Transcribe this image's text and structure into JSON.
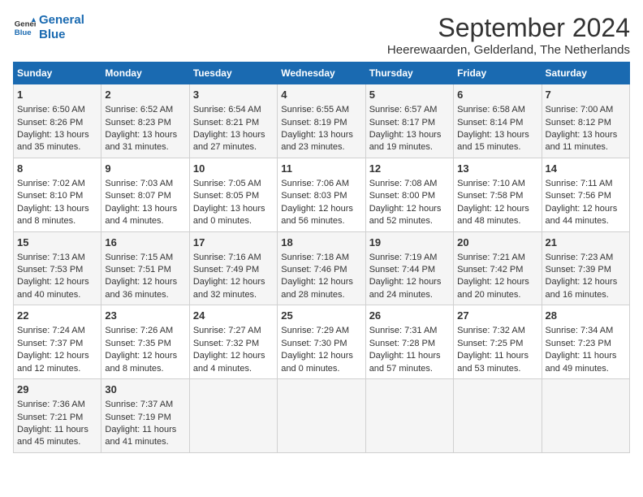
{
  "header": {
    "logo_line1": "General",
    "logo_line2": "Blue",
    "title": "September 2024",
    "subtitle": "Heerewaarden, Gelderland, The Netherlands"
  },
  "weekdays": [
    "Sunday",
    "Monday",
    "Tuesday",
    "Wednesday",
    "Thursday",
    "Friday",
    "Saturday"
  ],
  "weeks": [
    [
      {
        "day": "1",
        "lines": [
          "Sunrise: 6:50 AM",
          "Sunset: 8:26 PM",
          "Daylight: 13 hours",
          "and 35 minutes."
        ]
      },
      {
        "day": "2",
        "lines": [
          "Sunrise: 6:52 AM",
          "Sunset: 8:23 PM",
          "Daylight: 13 hours",
          "and 31 minutes."
        ]
      },
      {
        "day": "3",
        "lines": [
          "Sunrise: 6:54 AM",
          "Sunset: 8:21 PM",
          "Daylight: 13 hours",
          "and 27 minutes."
        ]
      },
      {
        "day": "4",
        "lines": [
          "Sunrise: 6:55 AM",
          "Sunset: 8:19 PM",
          "Daylight: 13 hours",
          "and 23 minutes."
        ]
      },
      {
        "day": "5",
        "lines": [
          "Sunrise: 6:57 AM",
          "Sunset: 8:17 PM",
          "Daylight: 13 hours",
          "and 19 minutes."
        ]
      },
      {
        "day": "6",
        "lines": [
          "Sunrise: 6:58 AM",
          "Sunset: 8:14 PM",
          "Daylight: 13 hours",
          "and 15 minutes."
        ]
      },
      {
        "day": "7",
        "lines": [
          "Sunrise: 7:00 AM",
          "Sunset: 8:12 PM",
          "Daylight: 13 hours",
          "and 11 minutes."
        ]
      }
    ],
    [
      {
        "day": "8",
        "lines": [
          "Sunrise: 7:02 AM",
          "Sunset: 8:10 PM",
          "Daylight: 13 hours",
          "and 8 minutes."
        ]
      },
      {
        "day": "9",
        "lines": [
          "Sunrise: 7:03 AM",
          "Sunset: 8:07 PM",
          "Daylight: 13 hours",
          "and 4 minutes."
        ]
      },
      {
        "day": "10",
        "lines": [
          "Sunrise: 7:05 AM",
          "Sunset: 8:05 PM",
          "Daylight: 13 hours",
          "and 0 minutes."
        ]
      },
      {
        "day": "11",
        "lines": [
          "Sunrise: 7:06 AM",
          "Sunset: 8:03 PM",
          "Daylight: 12 hours",
          "and 56 minutes."
        ]
      },
      {
        "day": "12",
        "lines": [
          "Sunrise: 7:08 AM",
          "Sunset: 8:00 PM",
          "Daylight: 12 hours",
          "and 52 minutes."
        ]
      },
      {
        "day": "13",
        "lines": [
          "Sunrise: 7:10 AM",
          "Sunset: 7:58 PM",
          "Daylight: 12 hours",
          "and 48 minutes."
        ]
      },
      {
        "day": "14",
        "lines": [
          "Sunrise: 7:11 AM",
          "Sunset: 7:56 PM",
          "Daylight: 12 hours",
          "and 44 minutes."
        ]
      }
    ],
    [
      {
        "day": "15",
        "lines": [
          "Sunrise: 7:13 AM",
          "Sunset: 7:53 PM",
          "Daylight: 12 hours",
          "and 40 minutes."
        ]
      },
      {
        "day": "16",
        "lines": [
          "Sunrise: 7:15 AM",
          "Sunset: 7:51 PM",
          "Daylight: 12 hours",
          "and 36 minutes."
        ]
      },
      {
        "day": "17",
        "lines": [
          "Sunrise: 7:16 AM",
          "Sunset: 7:49 PM",
          "Daylight: 12 hours",
          "and 32 minutes."
        ]
      },
      {
        "day": "18",
        "lines": [
          "Sunrise: 7:18 AM",
          "Sunset: 7:46 PM",
          "Daylight: 12 hours",
          "and 28 minutes."
        ]
      },
      {
        "day": "19",
        "lines": [
          "Sunrise: 7:19 AM",
          "Sunset: 7:44 PM",
          "Daylight: 12 hours",
          "and 24 minutes."
        ]
      },
      {
        "day": "20",
        "lines": [
          "Sunrise: 7:21 AM",
          "Sunset: 7:42 PM",
          "Daylight: 12 hours",
          "and 20 minutes."
        ]
      },
      {
        "day": "21",
        "lines": [
          "Sunrise: 7:23 AM",
          "Sunset: 7:39 PM",
          "Daylight: 12 hours",
          "and 16 minutes."
        ]
      }
    ],
    [
      {
        "day": "22",
        "lines": [
          "Sunrise: 7:24 AM",
          "Sunset: 7:37 PM",
          "Daylight: 12 hours",
          "and 12 minutes."
        ]
      },
      {
        "day": "23",
        "lines": [
          "Sunrise: 7:26 AM",
          "Sunset: 7:35 PM",
          "Daylight: 12 hours",
          "and 8 minutes."
        ]
      },
      {
        "day": "24",
        "lines": [
          "Sunrise: 7:27 AM",
          "Sunset: 7:32 PM",
          "Daylight: 12 hours",
          "and 4 minutes."
        ]
      },
      {
        "day": "25",
        "lines": [
          "Sunrise: 7:29 AM",
          "Sunset: 7:30 PM",
          "Daylight: 12 hours",
          "and 0 minutes."
        ]
      },
      {
        "day": "26",
        "lines": [
          "Sunrise: 7:31 AM",
          "Sunset: 7:28 PM",
          "Daylight: 11 hours",
          "and 57 minutes."
        ]
      },
      {
        "day": "27",
        "lines": [
          "Sunrise: 7:32 AM",
          "Sunset: 7:25 PM",
          "Daylight: 11 hours",
          "and 53 minutes."
        ]
      },
      {
        "day": "28",
        "lines": [
          "Sunrise: 7:34 AM",
          "Sunset: 7:23 PM",
          "Daylight: 11 hours",
          "and 49 minutes."
        ]
      }
    ],
    [
      {
        "day": "29",
        "lines": [
          "Sunrise: 7:36 AM",
          "Sunset: 7:21 PM",
          "Daylight: 11 hours",
          "and 45 minutes."
        ]
      },
      {
        "day": "30",
        "lines": [
          "Sunrise: 7:37 AM",
          "Sunset: 7:19 PM",
          "Daylight: 11 hours",
          "and 41 minutes."
        ]
      },
      {
        "day": "",
        "lines": []
      },
      {
        "day": "",
        "lines": []
      },
      {
        "day": "",
        "lines": []
      },
      {
        "day": "",
        "lines": []
      },
      {
        "day": "",
        "lines": []
      }
    ]
  ]
}
